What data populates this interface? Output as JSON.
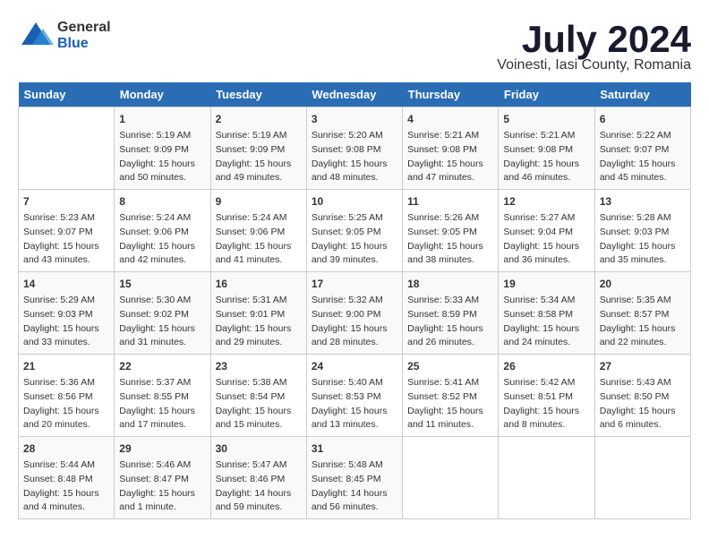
{
  "header": {
    "logo_general": "General",
    "logo_blue": "Blue",
    "month_year": "July 2024",
    "location": "Voinesti, Iasi County, Romania"
  },
  "days_of_week": [
    "Sunday",
    "Monday",
    "Tuesday",
    "Wednesday",
    "Thursday",
    "Friday",
    "Saturday"
  ],
  "weeks": [
    [
      null,
      {
        "day": 1,
        "sunrise": "5:19 AM",
        "sunset": "9:09 PM",
        "daylight": "15 hours and 50 minutes."
      },
      {
        "day": 2,
        "sunrise": "5:19 AM",
        "sunset": "9:09 PM",
        "daylight": "15 hours and 49 minutes."
      },
      {
        "day": 3,
        "sunrise": "5:20 AM",
        "sunset": "9:08 PM",
        "daylight": "15 hours and 48 minutes."
      },
      {
        "day": 4,
        "sunrise": "5:21 AM",
        "sunset": "9:08 PM",
        "daylight": "15 hours and 47 minutes."
      },
      {
        "day": 5,
        "sunrise": "5:21 AM",
        "sunset": "9:08 PM",
        "daylight": "15 hours and 46 minutes."
      },
      {
        "day": 6,
        "sunrise": "5:22 AM",
        "sunset": "9:07 PM",
        "daylight": "15 hours and 45 minutes."
      }
    ],
    [
      {
        "day": 7,
        "sunrise": "5:23 AM",
        "sunset": "9:07 PM",
        "daylight": "15 hours and 43 minutes."
      },
      {
        "day": 8,
        "sunrise": "5:24 AM",
        "sunset": "9:06 PM",
        "daylight": "15 hours and 42 minutes."
      },
      {
        "day": 9,
        "sunrise": "5:24 AM",
        "sunset": "9:06 PM",
        "daylight": "15 hours and 41 minutes."
      },
      {
        "day": 10,
        "sunrise": "5:25 AM",
        "sunset": "9:05 PM",
        "daylight": "15 hours and 39 minutes."
      },
      {
        "day": 11,
        "sunrise": "5:26 AM",
        "sunset": "9:05 PM",
        "daylight": "15 hours and 38 minutes."
      },
      {
        "day": 12,
        "sunrise": "5:27 AM",
        "sunset": "9:04 PM",
        "daylight": "15 hours and 36 minutes."
      },
      {
        "day": 13,
        "sunrise": "5:28 AM",
        "sunset": "9:03 PM",
        "daylight": "15 hours and 35 minutes."
      }
    ],
    [
      {
        "day": 14,
        "sunrise": "5:29 AM",
        "sunset": "9:03 PM",
        "daylight": "15 hours and 33 minutes."
      },
      {
        "day": 15,
        "sunrise": "5:30 AM",
        "sunset": "9:02 PM",
        "daylight": "15 hours and 31 minutes."
      },
      {
        "day": 16,
        "sunrise": "5:31 AM",
        "sunset": "9:01 PM",
        "daylight": "15 hours and 29 minutes."
      },
      {
        "day": 17,
        "sunrise": "5:32 AM",
        "sunset": "9:00 PM",
        "daylight": "15 hours and 28 minutes."
      },
      {
        "day": 18,
        "sunrise": "5:33 AM",
        "sunset": "8:59 PM",
        "daylight": "15 hours and 26 minutes."
      },
      {
        "day": 19,
        "sunrise": "5:34 AM",
        "sunset": "8:58 PM",
        "daylight": "15 hours and 24 minutes."
      },
      {
        "day": 20,
        "sunrise": "5:35 AM",
        "sunset": "8:57 PM",
        "daylight": "15 hours and 22 minutes."
      }
    ],
    [
      {
        "day": 21,
        "sunrise": "5:36 AM",
        "sunset": "8:56 PM",
        "daylight": "15 hours and 20 minutes."
      },
      {
        "day": 22,
        "sunrise": "5:37 AM",
        "sunset": "8:55 PM",
        "daylight": "15 hours and 17 minutes."
      },
      {
        "day": 23,
        "sunrise": "5:38 AM",
        "sunset": "8:54 PM",
        "daylight": "15 hours and 15 minutes."
      },
      {
        "day": 24,
        "sunrise": "5:40 AM",
        "sunset": "8:53 PM",
        "daylight": "15 hours and 13 minutes."
      },
      {
        "day": 25,
        "sunrise": "5:41 AM",
        "sunset": "8:52 PM",
        "daylight": "15 hours and 11 minutes."
      },
      {
        "day": 26,
        "sunrise": "5:42 AM",
        "sunset": "8:51 PM",
        "daylight": "15 hours and 8 minutes."
      },
      {
        "day": 27,
        "sunrise": "5:43 AM",
        "sunset": "8:50 PM",
        "daylight": "15 hours and 6 minutes."
      }
    ],
    [
      {
        "day": 28,
        "sunrise": "5:44 AM",
        "sunset": "8:48 PM",
        "daylight": "15 hours and 4 minutes."
      },
      {
        "day": 29,
        "sunrise": "5:46 AM",
        "sunset": "8:47 PM",
        "daylight": "15 hours and 1 minute."
      },
      {
        "day": 30,
        "sunrise": "5:47 AM",
        "sunset": "8:46 PM",
        "daylight": "14 hours and 59 minutes."
      },
      {
        "day": 31,
        "sunrise": "5:48 AM",
        "sunset": "8:45 PM",
        "daylight": "14 hours and 56 minutes."
      },
      null,
      null,
      null
    ]
  ],
  "labels": {
    "sunrise": "Sunrise:",
    "sunset": "Sunset:",
    "daylight": "Daylight:"
  }
}
